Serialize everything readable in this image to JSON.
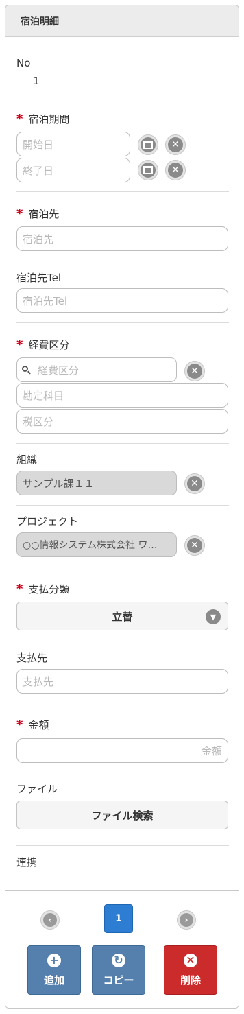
{
  "panel": {
    "title": "宿泊明細"
  },
  "no": {
    "label": "No",
    "value": "1"
  },
  "period": {
    "label": "宿泊期間",
    "start_placeholder": "開始日",
    "end_placeholder": "終了日"
  },
  "lodging": {
    "label": "宿泊先",
    "placeholder": "宿泊先"
  },
  "lodging_tel": {
    "label": "宿泊先Tel",
    "placeholder": "宿泊先Tel"
  },
  "expense": {
    "label": "経費区分",
    "placeholder": "経費区分",
    "account_placeholder": "勘定科目",
    "tax_placeholder": "税区分"
  },
  "organization": {
    "label": "組織",
    "value": "サンプル課１１"
  },
  "project": {
    "label": "プロジェクト",
    "value": "○○情報システム株式会社 ワ…"
  },
  "payment_type": {
    "label": "支払分類",
    "value": "立替"
  },
  "payee": {
    "label": "支払先",
    "placeholder": "支払先"
  },
  "amount": {
    "label": "金額",
    "placeholder": "金額"
  },
  "file": {
    "label": "ファイル",
    "button": "ファイル検索"
  },
  "link": {
    "label": "連携"
  },
  "pager": {
    "current": "1"
  },
  "actions": {
    "add": "追加",
    "copy": "コピー",
    "delete": "削除"
  },
  "required_mark": "*",
  "colors": {
    "required": "#d0021b",
    "primary": "#2d7ed2",
    "action_blue": "#5580ad",
    "danger": "#cc2b2b"
  }
}
